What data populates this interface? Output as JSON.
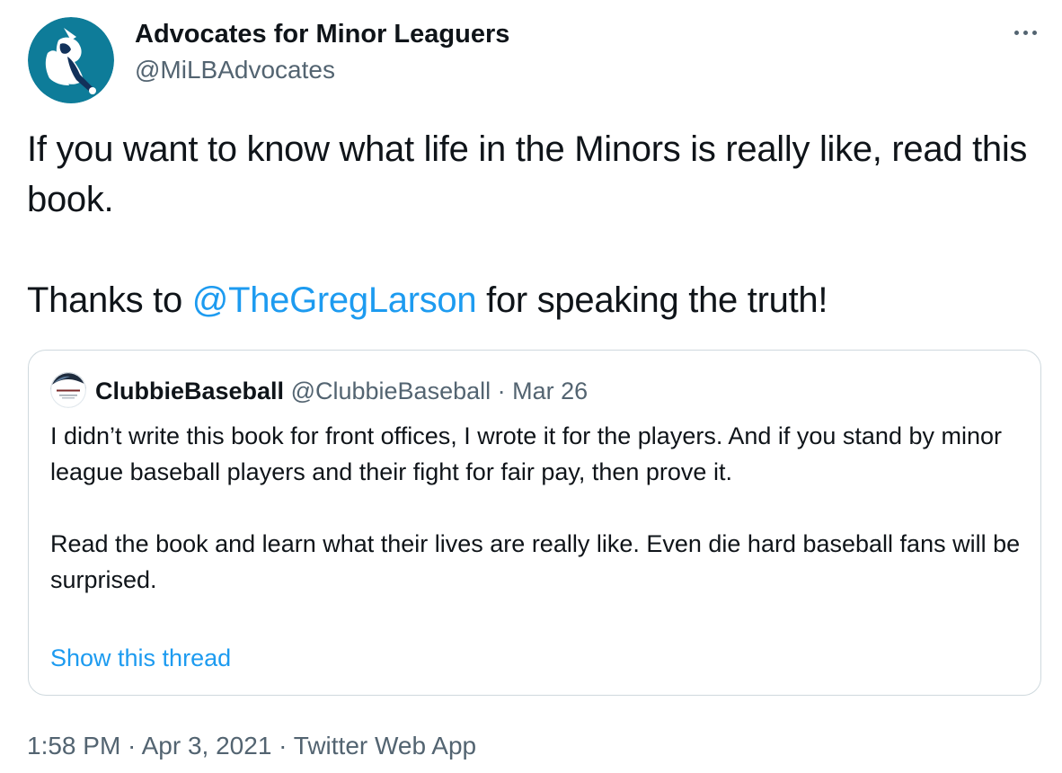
{
  "author": {
    "display_name": "Advocates for Minor Leaguers",
    "handle": "@MiLBAdvocates",
    "avatar_icon": "baseball-player-silhouette-logo",
    "avatar_color": "#0e7c99"
  },
  "menu": {
    "icon": "more-dots-icon"
  },
  "tweet": {
    "line1": "If you want to know what life in the Minors is really like, read this book.",
    "line2_prefix": "Thanks to ",
    "line2_mention": "@TheGregLarson",
    "line2_suffix": " for speaking the truth!"
  },
  "quoted_tweet": {
    "avatar_icon": "clubbie-book-logo",
    "display_name": "ClubbieBaseball",
    "handle": "@ClubbieBaseball",
    "separator": "·",
    "date": "Mar 26",
    "paragraph1": "I didn’t write this book for front offices, I wrote it for the players. And if you stand by minor league baseball players and their fight for fair pay, then prove it.",
    "paragraph2": "Read the book and learn what their lives are really like. Even die hard baseball fans will be surprised.",
    "show_thread": "Show this thread"
  },
  "footer": {
    "timestamp": "1:58 PM · Apr 3, 2021 · Twitter Web App"
  },
  "colors": {
    "link": "#1d9bf0",
    "secondary_text": "#536471",
    "border": "#cfd9de"
  }
}
